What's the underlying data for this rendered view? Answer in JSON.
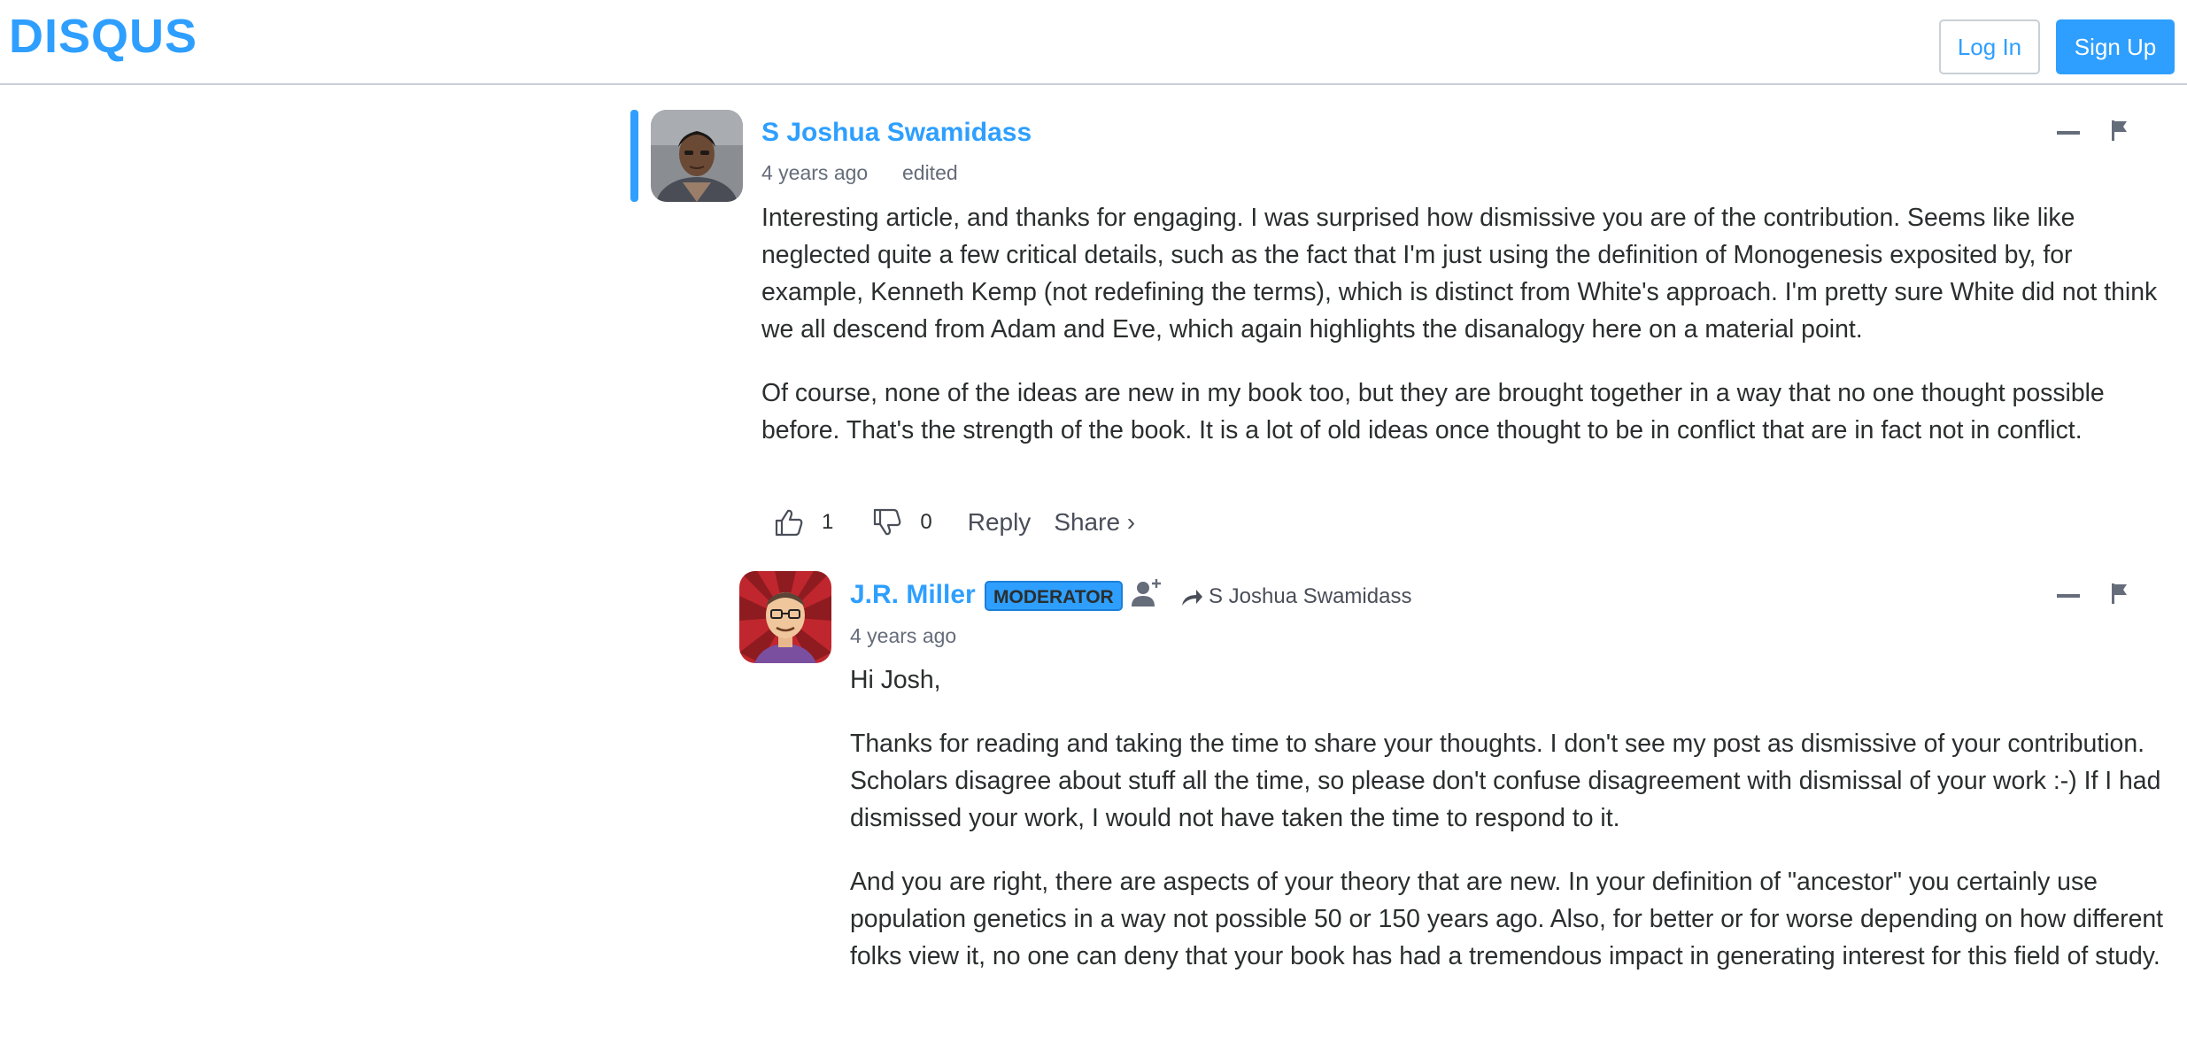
{
  "header": {
    "logo": "DISQUS",
    "login_label": "Log In",
    "signup_label": "Sign Up"
  },
  "colors": {
    "accent": "#2e9fff",
    "text": "#2a2e2e",
    "muted": "#656c7a"
  },
  "comments": [
    {
      "author": "S Joshua Swamidass",
      "time": "4 years ago",
      "edited": "edited",
      "paragraphs": [
        "Interesting article, and thanks for engaging. I was surprised how dismissive you are of the contribution. Seems like like neglected quite a few critical details, such as the fact that I'm just using the definition of Monogenesis exposited by, for example, Kenneth Kemp (not redefining the terms), which is distinct from White's approach. I'm pretty sure White did not think we all descend from Adam and Eve, which again highlights the disanalogy here on a material point.",
        "Of course, none of the ideas are new in my book too, but they are brought together in a way that no one thought possible before. That's the strength of the book. It is a lot of old ideas once thought to be in conflict that are in fact not in conflict."
      ],
      "upvotes": "1",
      "downvotes": "0",
      "reply_label": "Reply",
      "share_label": "Share ›"
    },
    {
      "author": "J.R. Miller",
      "badge": "MODERATOR",
      "reply_to": "S Joshua Swamidass",
      "time": "4 years ago",
      "paragraphs": [
        "Hi Josh,",
        "Thanks for reading and taking the time to share your thoughts. I don't see my post as dismissive of your contribution. Scholars disagree about stuff all the time, so please don't confuse disagreement with dismissal of your work :-) If I had dismissed your work, I would not have taken the time to respond to it.",
        "And you are right, there are aspects of your theory that are new. In your definition of \"ancestor\" you certainly use population genetics in a way not possible 50 or 150 years ago. Also, for better or for worse depending on how different folks view it, no one can deny that your book has had a tremendous impact in generating interest for this field of study."
      ]
    }
  ]
}
